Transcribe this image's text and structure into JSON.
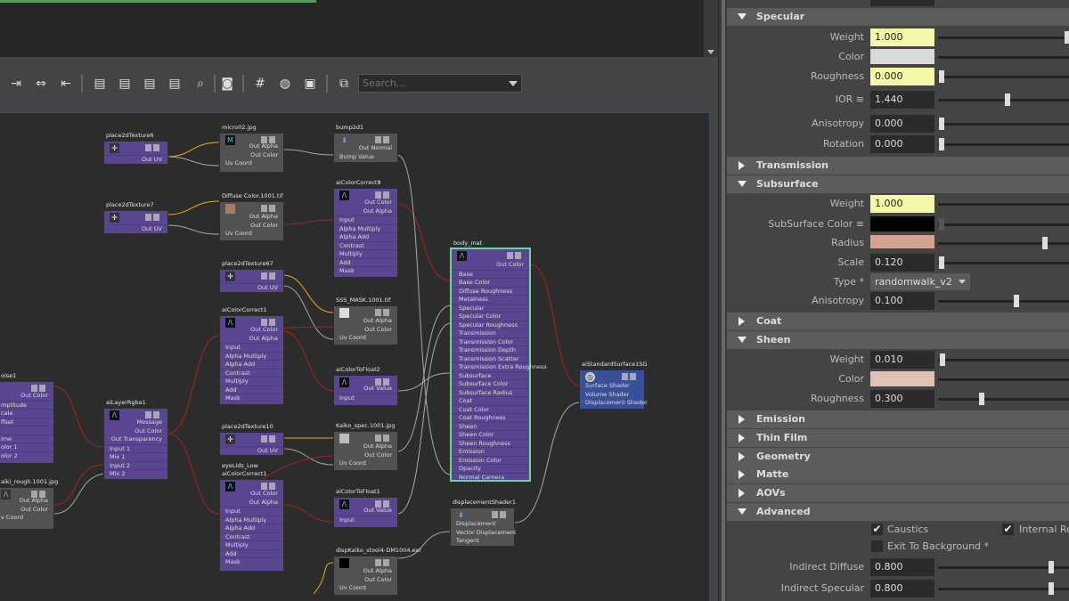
{
  "toolbar": {
    "search_placeholder": "Search..."
  },
  "nodes": {
    "place2dTexture6": {
      "title": "place2dTexture6",
      "out": "Out UV"
    },
    "micro02": {
      "title": "micro02.jpg",
      "out_alpha": "Out Alpha",
      "out_color": "Out Color",
      "uv": "Uv Coord"
    },
    "bump2d1": {
      "title": "bump2d1",
      "out_normal": "Out Normal",
      "bump_value": "Bump Value"
    },
    "place2dTexture7": {
      "title": "place2dTexture7",
      "out": "Out UV"
    },
    "diffuse_color": {
      "title": "Diffuse Color.1001.tif",
      "out_alpha": "Out Alpha",
      "out_color": "Out Color",
      "uv": "Uv Coord"
    },
    "aiColorCorrect8": {
      "title": "aiColorCorrect8",
      "out_color": "Out Color",
      "out_alpha": "Out Alpha",
      "inputs": [
        "Input",
        "Alpha Multiply",
        "Alpha Add",
        "Contrast",
        "Multiply",
        "Add",
        "Mask"
      ]
    },
    "place2dTexture67": {
      "title": "place2dTexture67",
      "out": "Out UV"
    },
    "sss_mask": {
      "title": "SSS_MASK.1001.tif",
      "out_alpha": "Out Alpha",
      "out_color": "Out Color",
      "uv": "Uv Coord"
    },
    "aiColorCorrect1a": {
      "title": "aiColorCorrect1",
      "out_color": "Out Color",
      "out_alpha": "Out Alpha",
      "inputs": [
        "Input",
        "Alpha Multiply",
        "Alpha Add",
        "Contrast",
        "Multiply",
        "Add",
        "Mask"
      ]
    },
    "aiColorToFloat2": {
      "title": "aiColorToFloat2",
      "out_value": "Out Value",
      "input": "Input"
    },
    "body_mat": {
      "title": "body_mat",
      "out_color": "Out Color",
      "inputs": [
        "Base",
        "Base Color",
        "Diffuse Roughness",
        "Metalness",
        "Specular",
        "Specular Color",
        "Specular Roughness",
        "Transmission",
        "Transmission Color",
        "Transmission Depth",
        "Transmission Scatter",
        "Transmission Extra Roughness",
        "Subsurface",
        "Subsurface Color",
        "Subsurface Radius",
        "Coat",
        "Coat Color",
        "Coat Roughness",
        "Sheen",
        "Sheen Color",
        "Sheen Roughness",
        "Emission",
        "Emission Color",
        "Opacity",
        "Normal Camera"
      ]
    },
    "aiStandardSurface1SG": {
      "title": "aiStandardSurface1SG",
      "inputs": [
        "Surface Shader",
        "Volume Shader",
        "Displacement Shader"
      ]
    },
    "noise1": {
      "title": "oise1",
      "out_color": "Out Color",
      "rows": [
        "mplitude",
        "cale",
        "ffset",
        "",
        "ime",
        "olor 1",
        "olor 2"
      ]
    },
    "aiLayerRgba1": {
      "title": "aiLayerRgba1",
      "message": "Message",
      "out_color": "Out Color",
      "out_transparency": "Out Transparency",
      "inputs": [
        "Input 1",
        "Mix 1",
        "Input 2",
        "Mix 2"
      ]
    },
    "place2dTexture10": {
      "title": "place2dTexture10",
      "out": "Out UV"
    },
    "kaiko_spec": {
      "title": "Kaiko_spec.1001.jpg",
      "out_alpha": "Out Alpha",
      "out_color": "Out Color",
      "uv": "Uv Coord"
    },
    "eyelids_low": {
      "title": "eyeLids_Low"
    },
    "aiColorCorrect1b": {
      "title": "aiColorCorrect1",
      "out_color": "Out Color",
      "out_alpha": "Out Alpha",
      "inputs": [
        "Input",
        "Alpha Multiply",
        "Alpha Add",
        "Contrast",
        "Multiply",
        "Add",
        "Mask"
      ]
    },
    "aiColorToFloat1": {
      "title": "aiColorToFloat1",
      "out_value": "Out Value",
      "input": "Input"
    },
    "displacementShader1": {
      "title": "displacementShader1",
      "inputs": [
        "Displacement",
        "Vector Displacement",
        "Tangent"
      ]
    },
    "kaiki_rough": {
      "title": "aiki_rough.1001.jpg",
      "out_alpha": "Out Alpha",
      "out_color": "Out Color",
      "uv": "v Coord"
    },
    "disp": {
      "title": "dispKaiko_stool4-DM1004.exr",
      "out_alpha": "Out Alpha",
      "out_color": "Out Color",
      "uv": "Uv Coord"
    }
  },
  "attr": {
    "specular": {
      "label": "Specular",
      "weight_label": "Weight",
      "weight": "1.000",
      "color_label": "Color",
      "color": "#d9d9d9",
      "roughness_label": "Roughness",
      "roughness": "0.000",
      "ior_label": "IOR ≡",
      "ior": "1.440",
      "anisotropy_label": "Anisotropy",
      "anisotropy": "0.000",
      "rotation_label": "Rotation",
      "rotation": "0.000"
    },
    "transmission": {
      "label": "Transmission"
    },
    "subsurface": {
      "label": "Subsurface",
      "weight_label": "Weight",
      "weight": "1.000",
      "color_label": "SubSurface Color ≡",
      "color": "#030303",
      "radius_label": "Radius",
      "radius_color": "#d3a291",
      "scale_label": "Scale",
      "scale": "0.120",
      "type_label": "Type *",
      "type": "randomwalk_v2",
      "anisotropy_label": "Anisotropy",
      "anisotropy": "0.100"
    },
    "coat": {
      "label": "Coat"
    },
    "sheen": {
      "label": "Sheen",
      "weight_label": "Weight",
      "weight": "0.010",
      "color_label": "Color",
      "color": "#e1c1b5",
      "roughness_label": "Roughness",
      "roughness": "0.300"
    },
    "emission": {
      "label": "Emission"
    },
    "thin_film": {
      "label": "Thin Film"
    },
    "geometry": {
      "label": "Geometry"
    },
    "matte": {
      "label": "Matte"
    },
    "aovs": {
      "label": "AOVs"
    },
    "advanced": {
      "label": "Advanced",
      "caustics": "Caustics",
      "internal_ref": "Internal Ref",
      "exit_to_bg": "Exit To Background *",
      "indirect_diffuse_label": "Indirect Diffuse",
      "indirect_diffuse": "0.800",
      "indirect_specular_label": "Indirect Specular",
      "indirect_specular": "0.800"
    }
  }
}
